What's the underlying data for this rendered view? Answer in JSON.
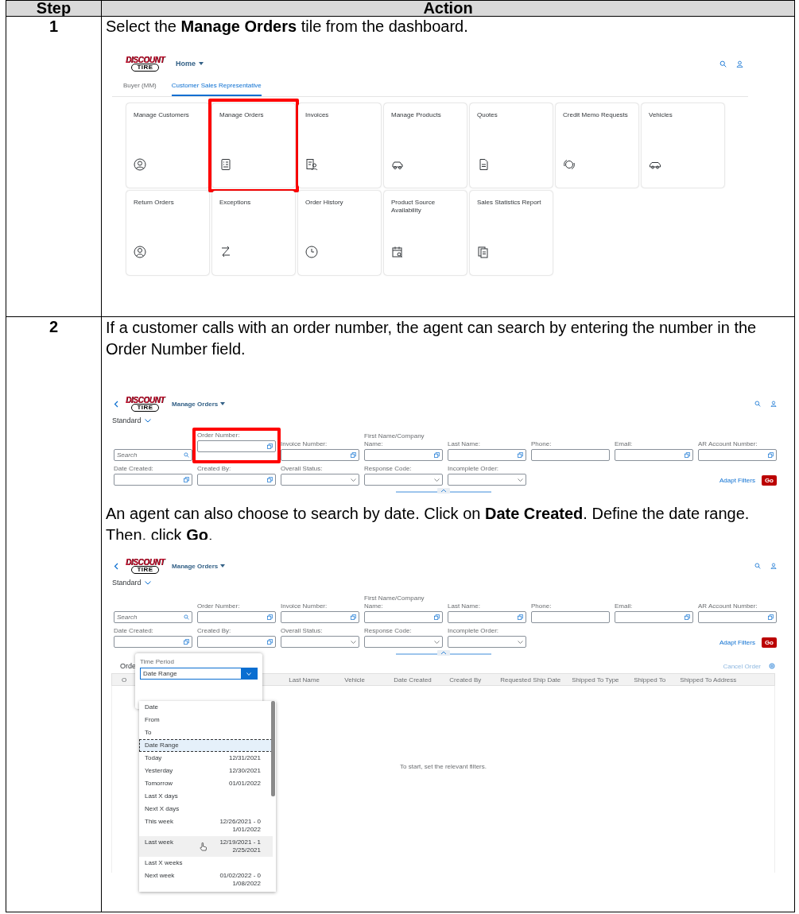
{
  "table": {
    "columns": [
      {
        "label": "Step"
      },
      {
        "label": "Action"
      }
    ],
    "rows": [
      {
        "step": "1",
        "blocks": [
          {
            "kind": "text",
            "text": "Select the **Manage Orders** tile from the dashboard."
          },
          {
            "kind": "launchpad",
            "logo": {
              "word": "DISCOUNT",
              "badge": "TIRE"
            },
            "title": "Home",
            "tabs": [
              {
                "label": "Buyer (MM)",
                "selected": false
              },
              {
                "label": "Customer Sales Representative",
                "selected": true
              }
            ],
            "tiles": [
              {
                "title": "Manage Customers",
                "highlighted": false
              },
              {
                "title": "Manage Orders",
                "highlighted": true
              },
              {
                "title": "Invoices",
                "highlighted": false
              },
              {
                "title": "Manage Products",
                "highlighted": false
              },
              {
                "title": "Quotes",
                "highlighted": false
              },
              {
                "title": "Credit Memo Requests",
                "highlighted": false
              },
              {
                "title": "Vehicles",
                "highlighted": false
              },
              {
                "title": "Return Orders",
                "highlighted": false
              },
              {
                "title": "Exceptions",
                "highlighted": false
              },
              {
                "title": "Order History",
                "highlighted": false
              },
              {
                "title": "Product Source Availability",
                "highlighted": false
              },
              {
                "title": "Sales Statistics Report",
                "highlighted": false
              }
            ]
          }
        ]
      },
      {
        "step": "2",
        "blocks": [
          {
            "kind": "text",
            "text": "If a customer calls with an order number, the agent can search by entering the number in the Order Number field."
          },
          {
            "kind": "filter_page",
            "logo": {
              "word": "DISCOUNT",
              "badge": "TIRE"
            },
            "title": "Manage Orders",
            "variant": "Standard",
            "fields": [
              {
                "kind": "search",
                "placeholder": "Search",
                "highlighted": false
              },
              {
                "kind": "value_help",
                "label": "Order Number:",
                "highlighted": true
              },
              {
                "kind": "value_help",
                "label": "Invoice Number:",
                "highlighted": false
              },
              {
                "kind": "value_help",
                "label": "First Name/Company Name:",
                "highlighted": false
              },
              {
                "kind": "value_help",
                "label": "Last Name:",
                "highlighted": false
              },
              {
                "kind": "input",
                "label": "Phone:",
                "highlighted": false
              },
              {
                "kind": "value_help",
                "label": "Email:",
                "highlighted": false
              },
              {
                "kind": "value_help",
                "label": "AR Account Number:",
                "highlighted": false
              },
              {
                "kind": "value_help",
                "label": "Date Created:",
                "highlighted": false
              },
              {
                "kind": "value_help",
                "label": "Created By:",
                "highlighted": false
              },
              {
                "kind": "select",
                "label": "Overall Status:",
                "highlighted": false
              },
              {
                "kind": "select",
                "label": "Response Code:",
                "highlighted": false
              },
              {
                "kind": "select",
                "label": "Incomplete Order:",
                "highlighted": false
              }
            ],
            "adapt_filters": "Adapt Filters",
            "go": "Go"
          },
          {
            "kind": "text",
            "text": "An agent can also choose to search by date. Click on **Date Created**. Define the date range. Then, click **Go**."
          },
          {
            "kind": "filter_page",
            "logo": {
              "word": "DISCOUNT",
              "badge": "TIRE"
            },
            "title": "Manage Orders",
            "variant": "Standard",
            "fields": [
              {
                "kind": "search",
                "placeholder": "Search",
                "highlighted": false
              },
              {
                "kind": "value_help",
                "label": "Order Number:",
                "highlighted": false
              },
              {
                "kind": "value_help",
                "label": "Invoice Number:",
                "highlighted": false
              },
              {
                "kind": "value_help",
                "label": "First Name/Company Name:",
                "highlighted": false
              },
              {
                "kind": "value_help",
                "label": "Last Name:",
                "highlighted": false
              },
              {
                "kind": "input",
                "label": "Phone:",
                "highlighted": false
              },
              {
                "kind": "value_help",
                "label": "Email:",
                "highlighted": false
              },
              {
                "kind": "value_help",
                "label": "AR Account Number:",
                "highlighted": false
              },
              {
                "kind": "value_help",
                "label": "Date Created:",
                "highlighted": false
              },
              {
                "kind": "value_help",
                "label": "Created By:",
                "highlighted": false
              },
              {
                "kind": "select",
                "label": "Overall Status:",
                "highlighted": false
              },
              {
                "kind": "select",
                "label": "Response Code:",
                "highlighted": false
              },
              {
                "kind": "select",
                "label": "Incomplete Order:",
                "highlighted": false
              }
            ],
            "adapt_filters": "Adapt Filters",
            "go": "Go",
            "results": {
              "title": "Orde",
              "action": "Cancel Order",
              "columns": [
                "O",
                "Last Name",
                "Vehicle",
                "Date Created",
                "Created By",
                "Requested Ship Date",
                "Shipped To Type",
                "Shipped To",
                "Shipped To Address"
              ],
              "empty_text": "To start, set the relevant filters."
            },
            "popover": {
              "label": "Time Period",
              "value": "Date Range",
              "options": [
                {
                  "label": "Date",
                  "selected": false,
                  "hovered": false
                },
                {
                  "label": "From",
                  "selected": false,
                  "hovered": false
                },
                {
                  "label": "To",
                  "selected": false,
                  "hovered": false
                },
                {
                  "label": "Date Range",
                  "selected": true,
                  "hovered": false
                },
                {
                  "label": "Today",
                  "date": "12/31/2021",
                  "selected": false,
                  "hovered": false
                },
                {
                  "label": "Yesterday",
                  "date": "12/30/2021",
                  "selected": false,
                  "hovered": false
                },
                {
                  "label": "Tomorrow",
                  "date": "01/01/2022",
                  "selected": false,
                  "hovered": false
                },
                {
                  "label": "Last X days",
                  "selected": false,
                  "hovered": false
                },
                {
                  "label": "Next X days",
                  "selected": false,
                  "hovered": false
                },
                {
                  "label": "This week",
                  "date": "12/26/2021 - 01/01/2022",
                  "selected": false,
                  "hovered": false
                },
                {
                  "label": "Last week",
                  "date": "12/19/2021 - 12/25/2021",
                  "selected": false,
                  "hovered": true
                },
                {
                  "label": "Last X weeks",
                  "selected": false,
                  "hovered": false
                },
                {
                  "label": "Next week",
                  "date": "01/02/2022 - 01/08/2022",
                  "selected": false,
                  "hovered": false
                }
              ]
            }
          }
        ]
      }
    ]
  }
}
